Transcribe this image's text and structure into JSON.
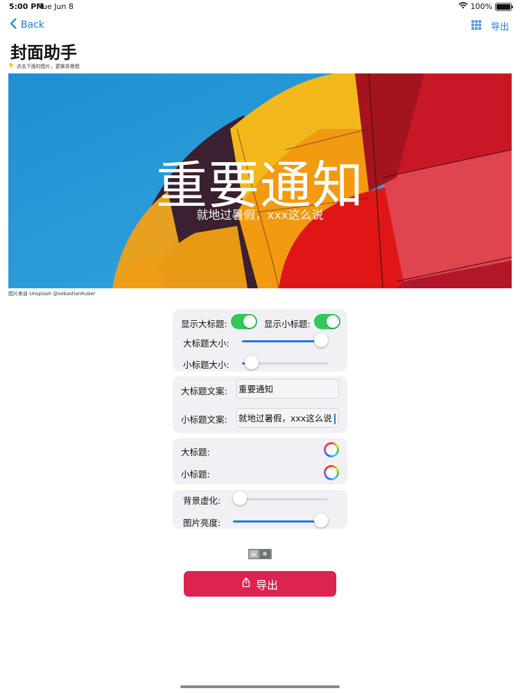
{
  "status_bar": {
    "time": "5:00 PM",
    "date": "Tue Jun 8",
    "battery": "100%"
  },
  "nav": {
    "back_label": "Back",
    "export_label": "导出",
    "grid_icon": "grid-icon"
  },
  "page": {
    "title": "封面助手",
    "hint": "点击下面的图片，更换背景图",
    "hint_icon": "👇"
  },
  "cover": {
    "title": "重要通知",
    "subtitle": "就地过暑假，xxx这么说",
    "credit": "图片来自 Unsplash @sebastianhuber"
  },
  "settings": {
    "show_title_label": "显示大标题:",
    "show_title_on": true,
    "show_subtitle_label": "显示小标题:",
    "show_subtitle_on": true,
    "title_size_label": "大标题大小:",
    "title_size_value": 0.92,
    "subtitle_size_label": "小标题大小:",
    "subtitle_size_value": 0.11
  },
  "text_settings": {
    "title_text_label": "大标题文案:",
    "title_text_value": "重要通知",
    "subtitle_text_label": "小标题文案:",
    "subtitle_text_value": "就地过暑假，xxx这么说"
  },
  "colors": {
    "title_color_label": "大标题:",
    "subtitle_color_label": "小标题:"
  },
  "image_settings": {
    "blur_label": "背景虚化:",
    "blur_value": 0.0,
    "brightness_label": "图片亮度:",
    "brightness_value": 1.0
  },
  "export_button": {
    "label": "导出",
    "color": "#dd2350"
  },
  "accent_color": "#1a7be0",
  "toggle_color": "#34c759"
}
